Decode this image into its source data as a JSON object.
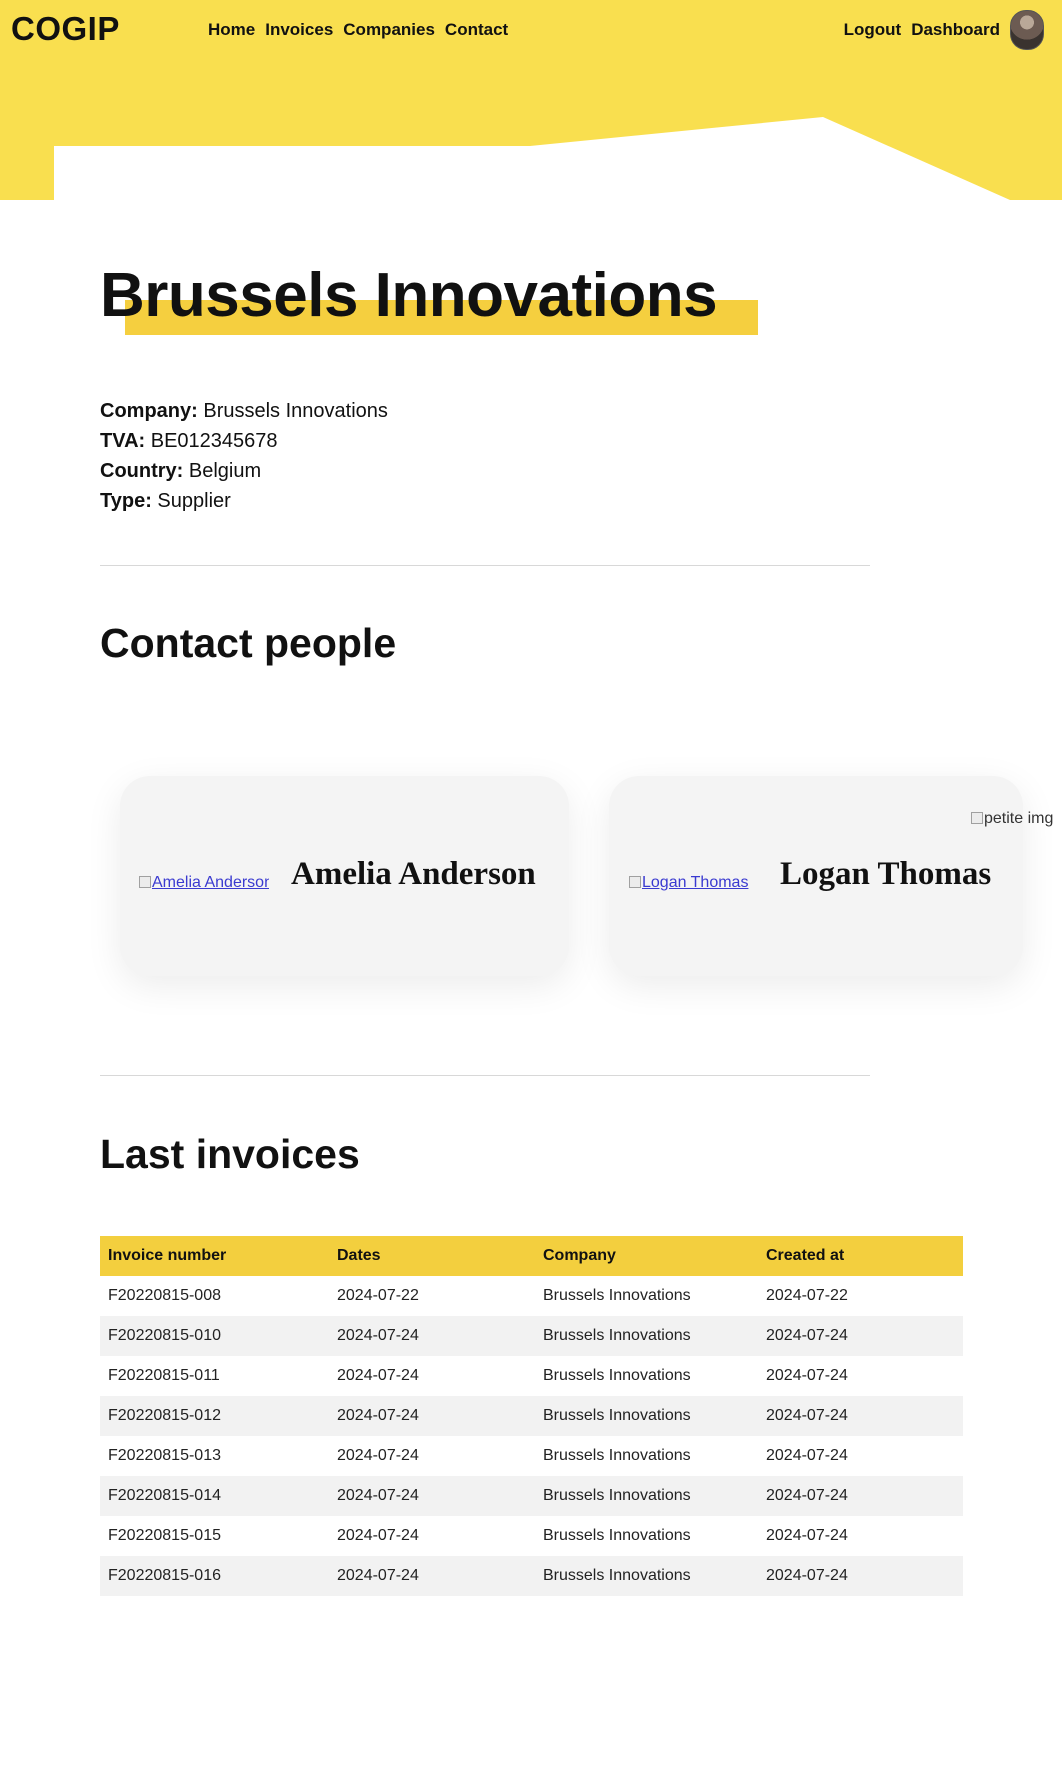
{
  "header": {
    "logo": "COGIP",
    "nav_left": [
      {
        "label": "Home"
      },
      {
        "label": "Invoices"
      },
      {
        "label": "Companies"
      },
      {
        "label": "Contact"
      }
    ],
    "nav_right": [
      {
        "label": "Logout"
      },
      {
        "label": "Dashboard"
      }
    ],
    "brand_color": "#f9df4f"
  },
  "company": {
    "title": "Brussels Innovations",
    "details": [
      {
        "label": "Company:",
        "value": "Brussels Innovations"
      },
      {
        "label": "TVA:",
        "value": "BE012345678"
      },
      {
        "label": "Country:",
        "value": "Belgium"
      },
      {
        "label": "Type:",
        "value": "Supplier"
      }
    ]
  },
  "contacts": {
    "title": "Contact people",
    "people": [
      {
        "image_alt": "Amelia Anderson",
        "name": "Amelia Anderson"
      },
      {
        "image_alt": "Logan Thomas",
        "name": "Logan Thomas"
      }
    ],
    "decor_image_alt": "petite img"
  },
  "invoices": {
    "title": "Last invoices",
    "columns": [
      "Invoice number",
      "Dates",
      "Company",
      "Created at"
    ],
    "rows": [
      [
        "F20220815-008",
        "2024-07-22",
        "Brussels Innovations",
        "2024-07-22"
      ],
      [
        "F20220815-010",
        "2024-07-24",
        "Brussels Innovations",
        "2024-07-24"
      ],
      [
        "F20220815-011",
        "2024-07-24",
        "Brussels Innovations",
        "2024-07-24"
      ],
      [
        "F20220815-012",
        "2024-07-24",
        "Brussels Innovations",
        "2024-07-24"
      ],
      [
        "F20220815-013",
        "2024-07-24",
        "Brussels Innovations",
        "2024-07-24"
      ],
      [
        "F20220815-014",
        "2024-07-24",
        "Brussels Innovations",
        "2024-07-24"
      ],
      [
        "F20220815-015",
        "2024-07-24",
        "Brussels Innovations",
        "2024-07-24"
      ],
      [
        "F20220815-016",
        "2024-07-24",
        "Brussels Innovations",
        "2024-07-24"
      ]
    ]
  }
}
